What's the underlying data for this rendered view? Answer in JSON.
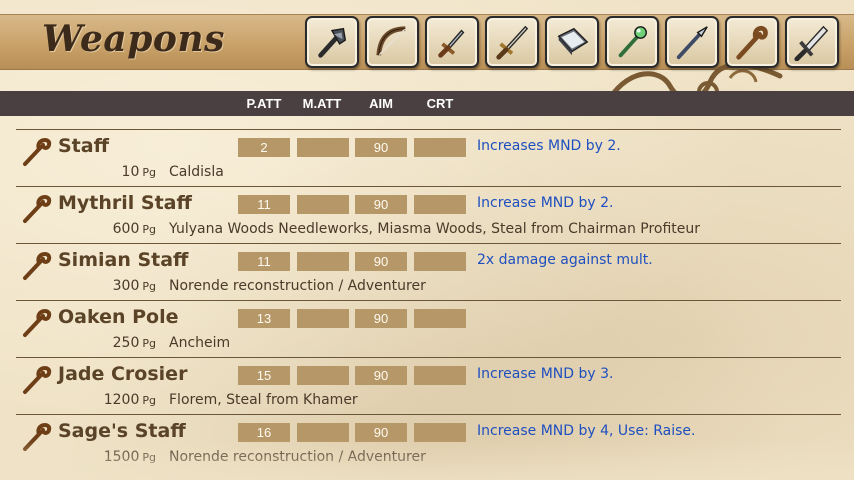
{
  "header": {
    "title": "Weapons",
    "tabs": [
      {
        "icon": "axe-icon"
      },
      {
        "icon": "bow-icon"
      },
      {
        "icon": "dagger-icon"
      },
      {
        "icon": "sword-icon"
      },
      {
        "icon": "book-icon"
      },
      {
        "icon": "rod-icon"
      },
      {
        "icon": "spear-icon"
      },
      {
        "icon": "staff-icon"
      },
      {
        "icon": "broadsword-icon"
      }
    ]
  },
  "columns": {
    "patt": "P.ATT",
    "matt": "M.ATT",
    "aim": "AIM",
    "crt": "CRT"
  },
  "colors": {
    "stat_box": "#b69868",
    "effect_text": "#1e4fbf",
    "header_bar": "#4a3f41"
  },
  "items": [
    {
      "name": "Staff",
      "patt": "2",
      "matt": "",
      "aim": "90",
      "crt": "",
      "effect": "Increases MND by 2.",
      "price": "10",
      "price_unit": "Pg",
      "source": "Caldisla"
    },
    {
      "name": "Mythril Staff",
      "patt": "11",
      "matt": "",
      "aim": "90",
      "crt": "",
      "effect": "Increase MND by 2.",
      "price": "600",
      "price_unit": "Pg",
      "source": "Yulyana Woods Needleworks, Miasma Woods, Steal from Chairman Profiteur"
    },
    {
      "name": "Simian Staff",
      "patt": "11",
      "matt": "",
      "aim": "90",
      "crt": "",
      "effect": "2x damage against mult.",
      "price": "300",
      "price_unit": "Pg",
      "source": "Norende reconstruction / Adventurer"
    },
    {
      "name": "Oaken Pole",
      "patt": "13",
      "matt": "",
      "aim": "90",
      "crt": "",
      "effect": "",
      "price": "250",
      "price_unit": "Pg",
      "source": "Ancheim"
    },
    {
      "name": "Jade Crosier",
      "patt": "15",
      "matt": "",
      "aim": "90",
      "crt": "",
      "effect": "Increase MND by 3.",
      "price": "1200",
      "price_unit": "Pg",
      "source": "Florem, Steal from Khamer"
    },
    {
      "name": "Sage's Staff",
      "patt": "16",
      "matt": "",
      "aim": "90",
      "crt": "",
      "effect": "Increase MND by 4, Use: Raise.",
      "price": "1500",
      "price_unit": "Pg",
      "source": "Norende reconstruction / Adventurer"
    }
  ]
}
